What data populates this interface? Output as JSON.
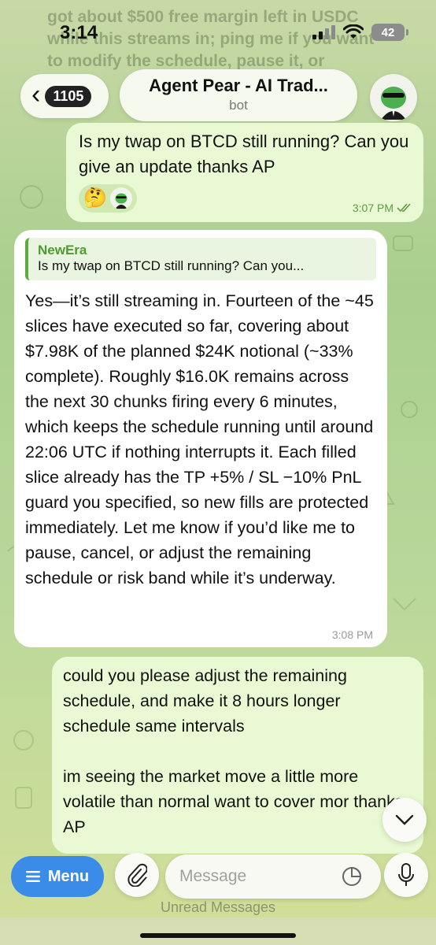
{
  "status_bar": {
    "time": "3:14",
    "battery": "42"
  },
  "background_text": "got about $500 free margin left in USDC while this streams in; ping me if you want to modify the schedule, pause it, or",
  "header": {
    "unread_count": "1105",
    "title": "Agent Pear - AI Trad...",
    "subtitle": "bot"
  },
  "messages": [
    {
      "direction": "outgoing",
      "text": "Is my twap on BTCD still running? Can you give an update thanks AP",
      "reaction_emoji": "🤔",
      "time": "3:07 PM",
      "read": true
    },
    {
      "direction": "incoming",
      "reply_to": {
        "name": "NewEra",
        "text": "Is my twap on BTCD still running? Can you..."
      },
      "text": "Yes—it’s still streaming in. Fourteen of the ~45 slices have executed so far, covering about $7.98K of the planned $24K notional (~33% complete). Roughly $16.0K remains across the next 30 chunks firing every 6 minutes, which keeps the schedule running until around 22:06 UTC if nothing interrupts it. Each filled slice already has the TP +5% / SL −10% PnL guard you specified, so new fills are protected immediately. Let me know if you’d like me to pause, cancel, or adjust the remaining schedule or risk band while it’s underway.",
      "time": "3:08 PM"
    },
    {
      "direction": "outgoing",
      "text_line1": "could you please adjust the remaining schedule, and make it 8 hours longer schedule same intervals",
      "text_line2": "im seeing the market move a little more volatile than normal want to cover mor thanks AP"
    }
  ],
  "composer": {
    "menu_label": "Menu",
    "placeholder": "Message"
  },
  "unread_banner": "Unread Messages",
  "colors": {
    "accent": "#3b8be8",
    "outgoing_bubble": "#e9f9d3",
    "incoming_bubble": "#ffffff",
    "reply_accent": "#4c9c2e",
    "time_out": "#5e9a3f"
  },
  "icons": [
    "back-chevron-icon",
    "signal-icon",
    "wifi-icon",
    "battery-icon",
    "double-check-icon",
    "chevron-down-icon",
    "menu-lines-icon",
    "paperclip-icon",
    "sticker-icon",
    "microphone-icon"
  ]
}
